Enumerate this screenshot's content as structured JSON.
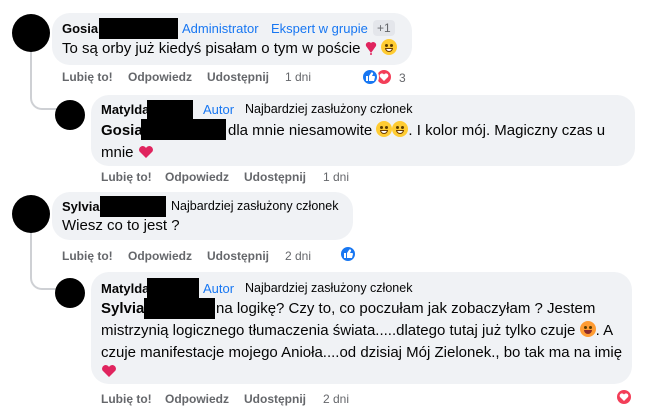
{
  "comments": [
    {
      "author": "Gosia",
      "role": "Administrator",
      "badge": "Ekspert w grupie",
      "badge_extra": "+1",
      "text": "To są orby już kiedyś pisałam o tym w poście",
      "actions": {
        "like": "Lubię to!",
        "reply": "Odpowiedz",
        "share": "Udostępnij",
        "time": "1 dni"
      },
      "reactions_count": "3"
    },
    {
      "author": "Matylda",
      "role": "Autor",
      "badge": "Najbardziej zasłużony członek",
      "mention": "Gosia",
      "text_1": "dla mnie niesamowite",
      "text_2": ". I kolor mój. Magiczny czas u",
      "text_3": "mnie",
      "actions": {
        "like": "Lubię to!",
        "reply": "Odpowiedz",
        "share": "Udostępnij",
        "time": "1 dni"
      }
    },
    {
      "author": "Sylvia",
      "badge": "Najbardziej zasłużony członek",
      "text": "Wiesz co to jest ?",
      "actions": {
        "like": "Lubię to!",
        "reply": "Odpowiedz",
        "share": "Udostępnij",
        "time": "2 dni"
      }
    },
    {
      "author": "Matylda",
      "role": "Autor",
      "badge": "Najbardziej zasłużony członek",
      "mention": "Sylvia",
      "text_1": "na logikę? Czy to, co poczułam jak zobaczyłam ? Jestem",
      "text_2": "mistrzynią logicznego tłumaczenia świata.....dlatego tutaj już tylko czuje",
      "text_2b": ". A",
      "text_3": "czuje manifestacje mojego Anioła....od dzisiaj Mój Zielonek., bo tak ma na imię",
      "actions": {
        "like": "Lubię to!",
        "reply": "Odpowiedz",
        "share": "Udostępnij",
        "time": "2 dni"
      }
    }
  ],
  "colors": {
    "bubble": "#f0f2f5",
    "link_blue": "#1877f2",
    "meta_grey": "#65676b",
    "like_blue": "#1877f2",
    "heart_red": "#f33e58"
  },
  "icons": [
    "like-icon",
    "heart-icon",
    "smile-emoji",
    "grin-emoji",
    "love-emoji"
  ]
}
